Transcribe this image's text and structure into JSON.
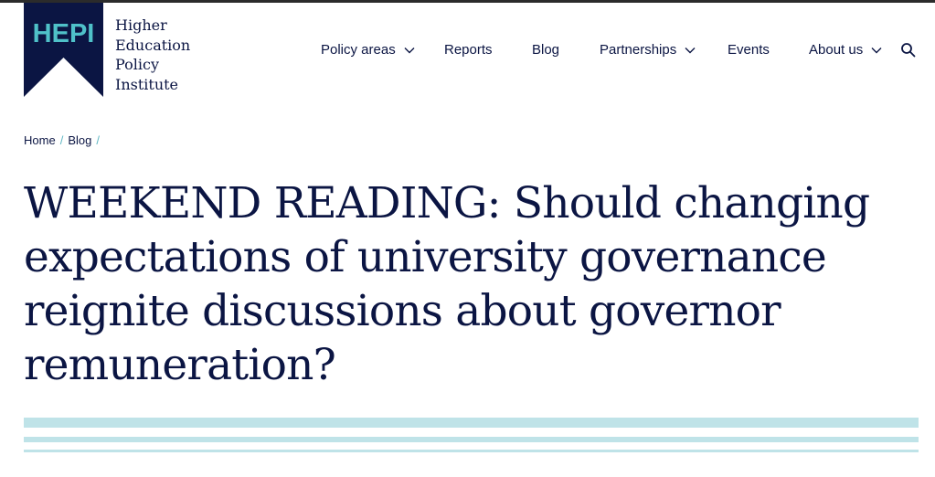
{
  "logo": {
    "mark_text": "HEPI",
    "lines": [
      "Higher",
      "Education",
      "Policy",
      "Institute"
    ],
    "colors": {
      "navy": "#0b1543",
      "teal": "#4fc1c9"
    }
  },
  "nav": {
    "items": [
      {
        "label": "Policy areas",
        "has_dropdown": true
      },
      {
        "label": "Reports",
        "has_dropdown": false
      },
      {
        "label": "Blog",
        "has_dropdown": false
      },
      {
        "label": "Partnerships",
        "has_dropdown": true
      },
      {
        "label": "Events",
        "has_dropdown": false
      },
      {
        "label": "About us",
        "has_dropdown": true
      }
    ],
    "search_icon": "search-icon",
    "dropdown_icon": "chevron-down-icon"
  },
  "breadcrumb": {
    "items": [
      "Home",
      "Blog"
    ],
    "separator": "/"
  },
  "article": {
    "title": "WEEKEND READING: Should changing expectations of university governance reignite discussions about governor remuneration?"
  },
  "theme": {
    "text": "#0b1543",
    "accent": "#5fb7c3",
    "stripe": "#bfe3e8"
  }
}
